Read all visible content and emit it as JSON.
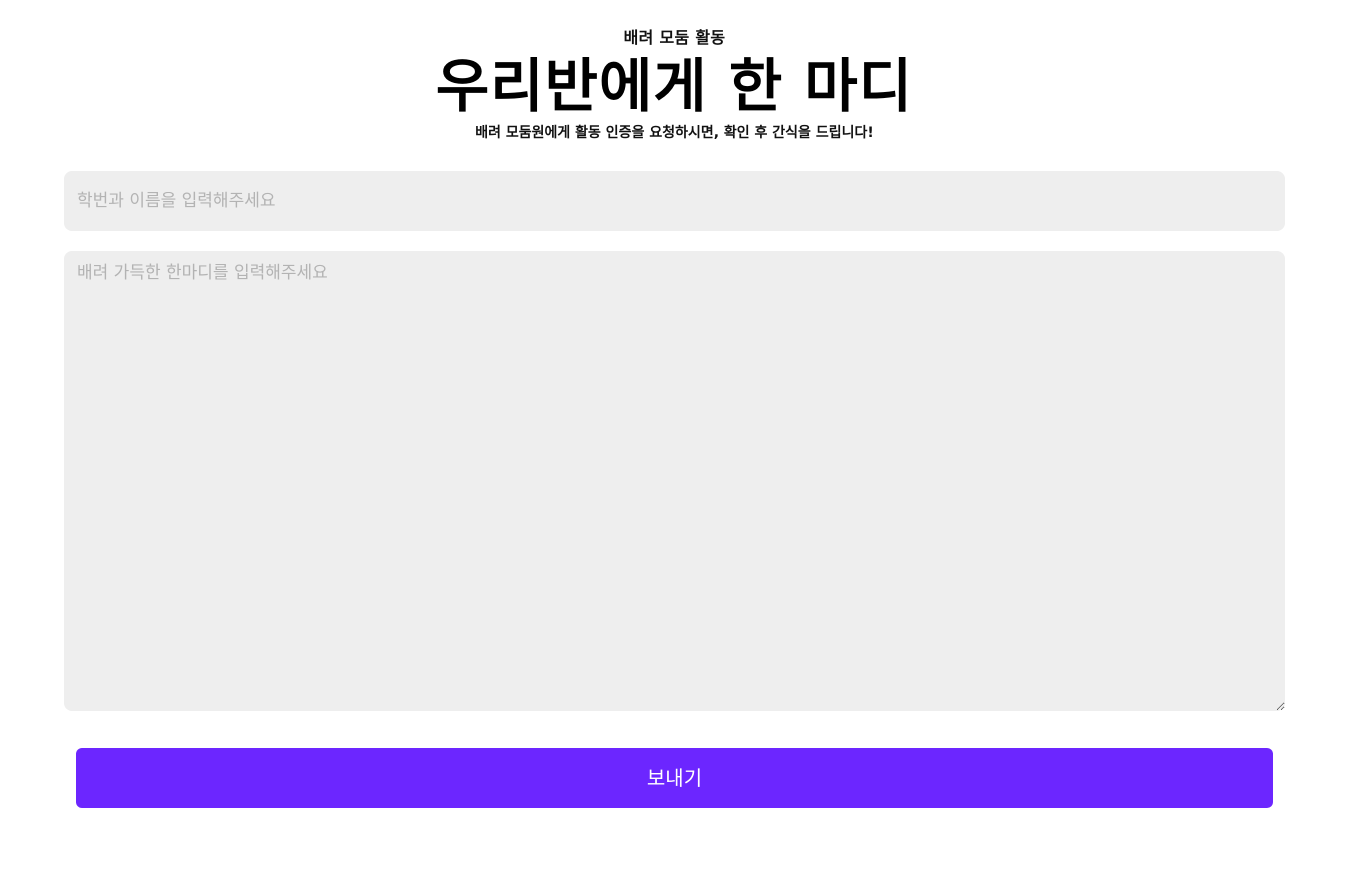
{
  "header": {
    "kicker": "배려 모둠 활동",
    "title": "우리반에게 한 마디",
    "subtitle": "배려 모둠원에게 활동 인증을 요청하시면, 확인 후 간식을 드립니다!"
  },
  "form": {
    "name_placeholder": "학번과 이름을 입력해주세요",
    "name_value": "",
    "message_placeholder": "배려 가득한 한마디를 입력해주세요",
    "message_value": "",
    "submit_label": "보내기"
  },
  "colors": {
    "accent": "#6c26ff",
    "field_background": "#eeeeee",
    "placeholder_text": "#b3b3b3"
  }
}
